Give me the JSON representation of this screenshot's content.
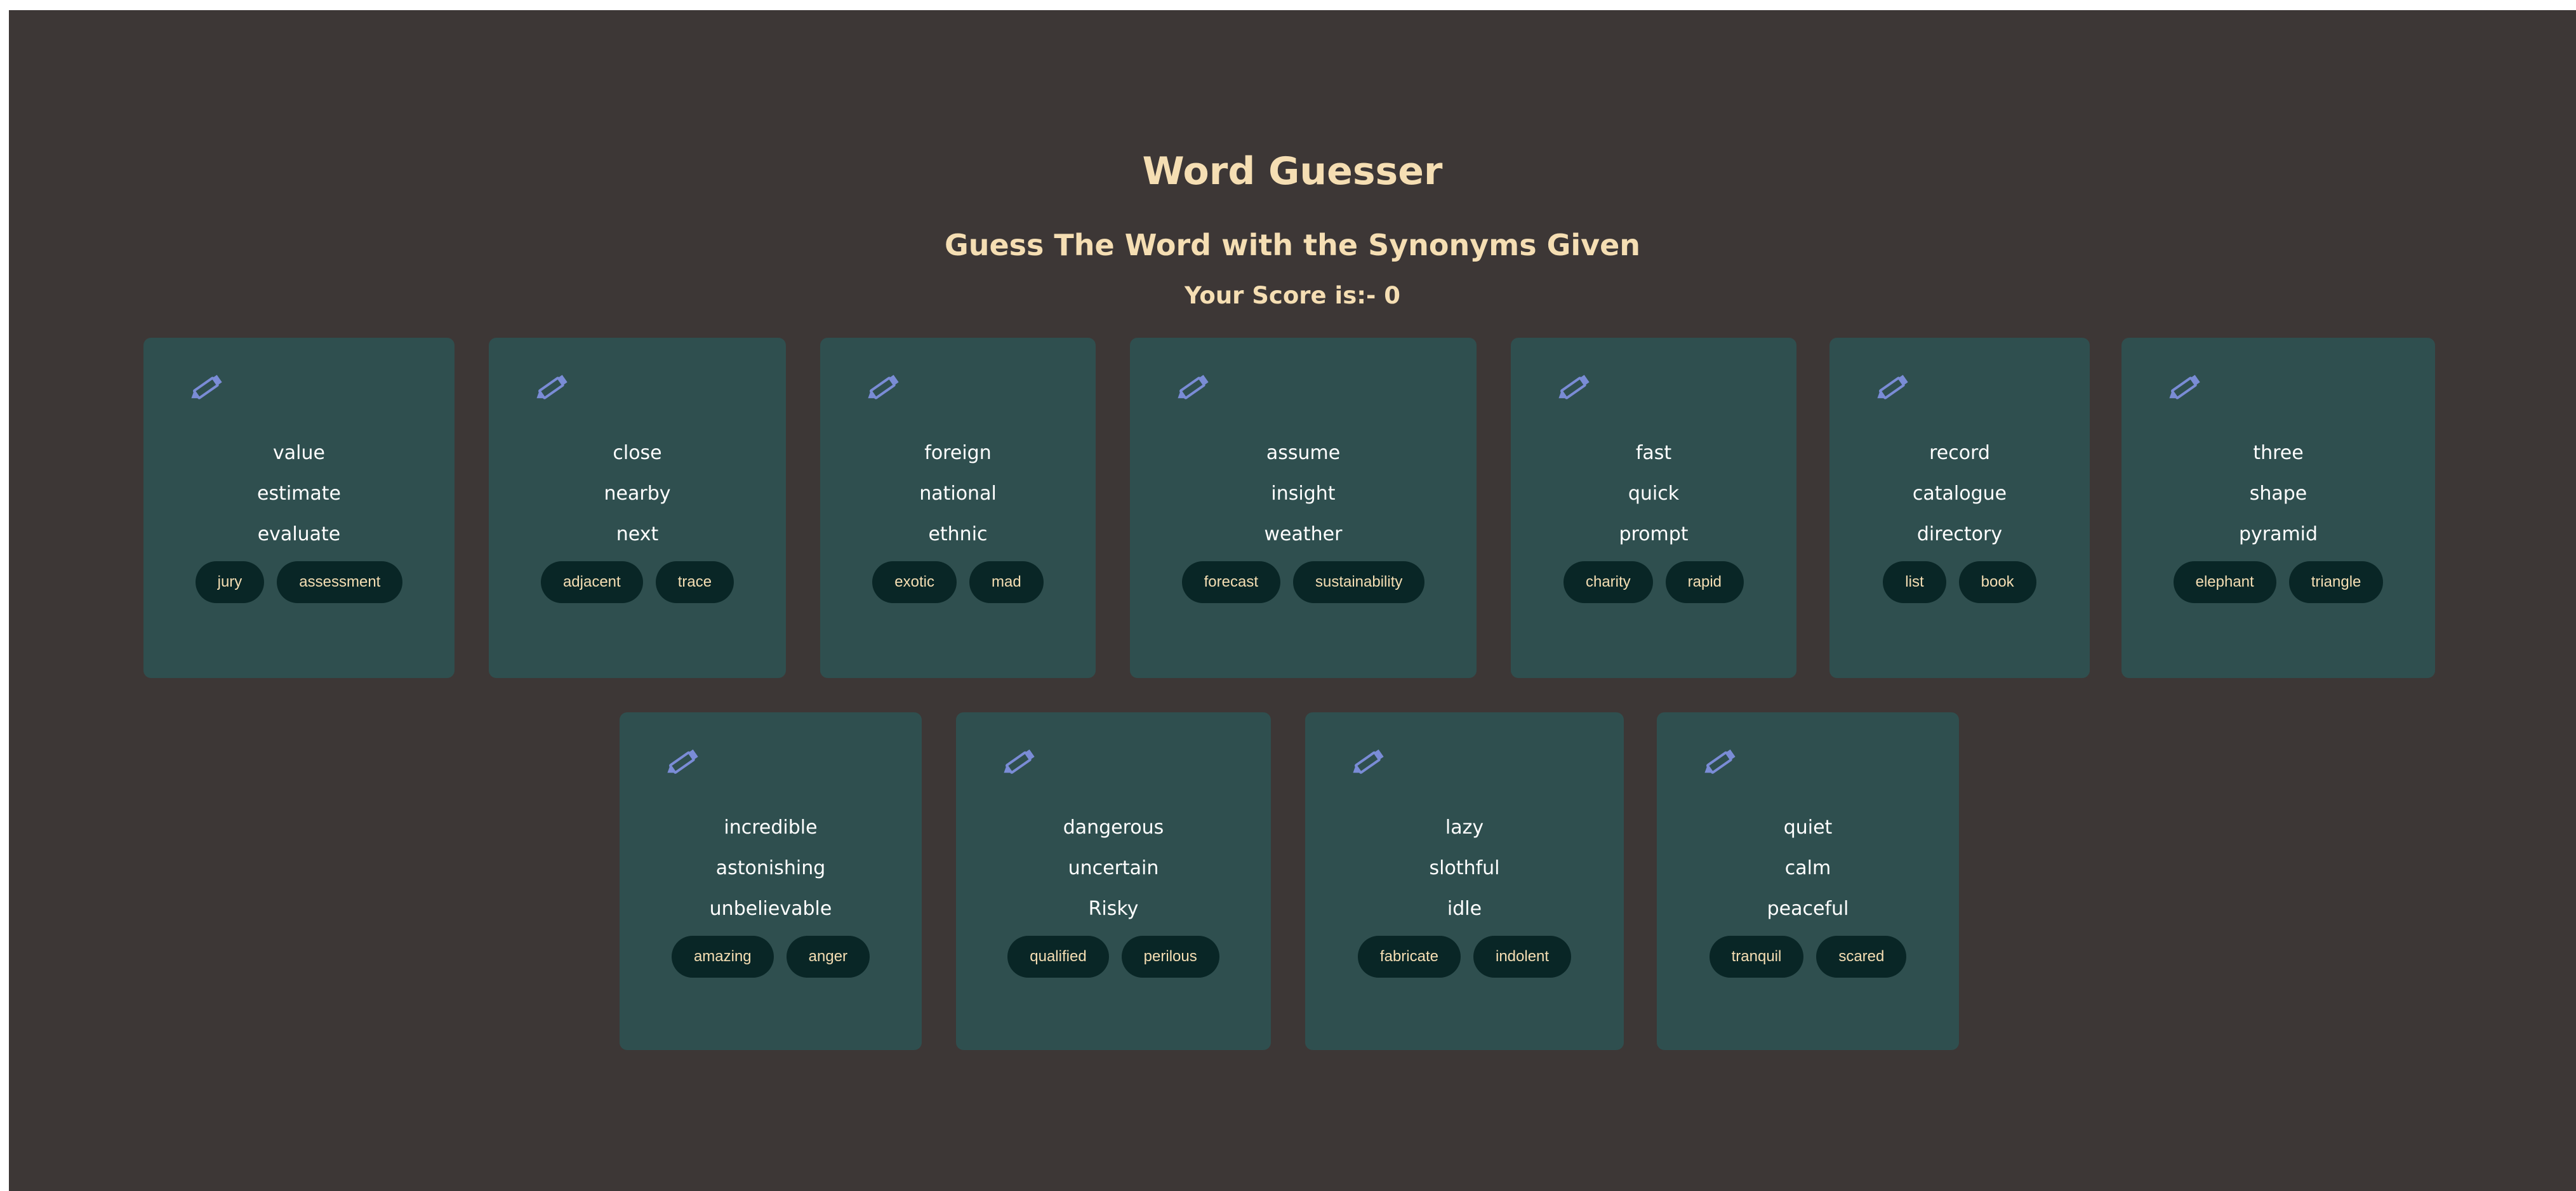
{
  "app": {
    "title": "Word Guesser",
    "subtitle": "Guess The Word with the Synonyms Given",
    "score_label": "Your Score is:- 0",
    "score": 0
  },
  "colors": {
    "background": "#3d3736",
    "heading": "#f5deb3",
    "card": "#2f4f4f",
    "option_button": "#092626",
    "option_text": "#f5deb3",
    "icon": "#7a8cd6"
  },
  "cards": [
    {
      "icon": "pencil-icon",
      "synonyms": [
        "value",
        "estimate",
        "evaluate"
      ],
      "options": [
        "jury",
        "assessment"
      ]
    },
    {
      "icon": "pencil-icon",
      "synonyms": [
        "close",
        "nearby",
        "next"
      ],
      "options": [
        "adjacent",
        "trace"
      ]
    },
    {
      "icon": "pencil-icon",
      "synonyms": [
        "foreign",
        "national",
        "ethnic"
      ],
      "options": [
        "exotic",
        "mad"
      ]
    },
    {
      "icon": "pencil-icon",
      "synonyms": [
        "assume",
        "insight",
        "weather"
      ],
      "options": [
        "forecast",
        "sustainability"
      ]
    },
    {
      "icon": "pencil-icon",
      "synonyms": [
        "fast",
        "quick",
        "prompt"
      ],
      "options": [
        "charity",
        "rapid"
      ]
    },
    {
      "icon": "pencil-icon",
      "synonyms": [
        "record",
        "catalogue",
        "directory"
      ],
      "options": [
        "list",
        "book"
      ]
    },
    {
      "icon": "pencil-icon",
      "synonyms": [
        "three",
        "shape",
        "pyramid"
      ],
      "options": [
        "elephant",
        "triangle"
      ]
    },
    {
      "icon": "pencil-icon",
      "synonyms": [
        "incredible",
        "astonishing",
        "unbelievable"
      ],
      "options": [
        "amazing",
        "anger"
      ]
    },
    {
      "icon": "pencil-icon",
      "synonyms": [
        "dangerous",
        "uncertain",
        "Risky"
      ],
      "options": [
        "qualified",
        "perilous"
      ]
    },
    {
      "icon": "pencil-icon",
      "synonyms": [
        "lazy",
        "slothful",
        "idle"
      ],
      "options": [
        "fabricate",
        "indolent"
      ]
    },
    {
      "icon": "pencil-icon",
      "synonyms": [
        "quiet",
        "calm",
        "peaceful"
      ],
      "options": [
        "tranquil",
        "scared"
      ]
    }
  ]
}
